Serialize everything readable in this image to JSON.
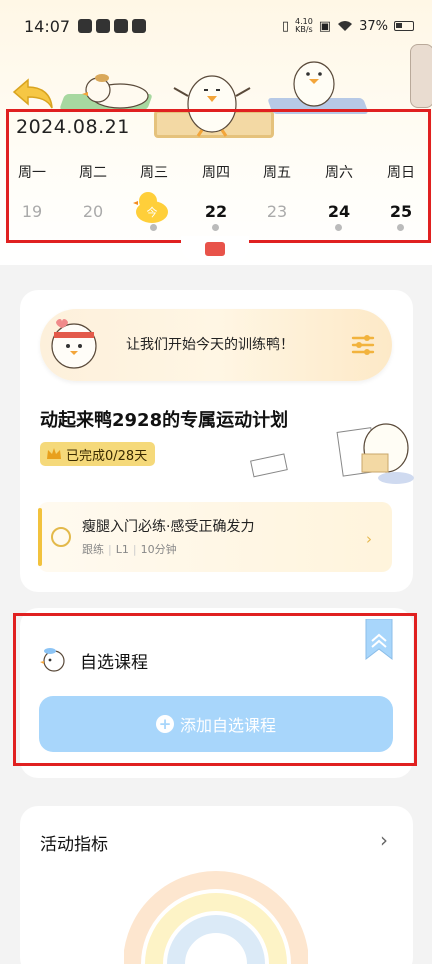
{
  "status_bar": {
    "time": "14:07",
    "net_speed_value": "4.10",
    "net_speed_unit": "KB/s",
    "battery": "37%"
  },
  "calendar": {
    "date": "2024.08.21",
    "weekdays": [
      "周一",
      "周二",
      "周三",
      "周四",
      "周五",
      "周六",
      "周日"
    ],
    "days": [
      "19",
      "20",
      "今",
      "22",
      "23",
      "24",
      "25"
    ],
    "today_label": "今"
  },
  "plan": {
    "banner_text": "让我们开始今天的训练鸭！",
    "title": "动起来鸭2928的专属运动计划",
    "progress_badge": "已完成0/28天",
    "lesson": {
      "title": "瘦腿入门必练·感受正确发力",
      "tag_type": "跟练",
      "tag_level": "L1",
      "tag_duration": "10分钟"
    }
  },
  "custom_courses": {
    "title": "自选课程",
    "add_button_label": "添加自选课程"
  },
  "activity": {
    "title": "活动指标"
  },
  "colors": {
    "accent_yellow": "#f2c23d",
    "add_button_bg": "#a8d6fb",
    "highlight_border": "#e02020"
  }
}
